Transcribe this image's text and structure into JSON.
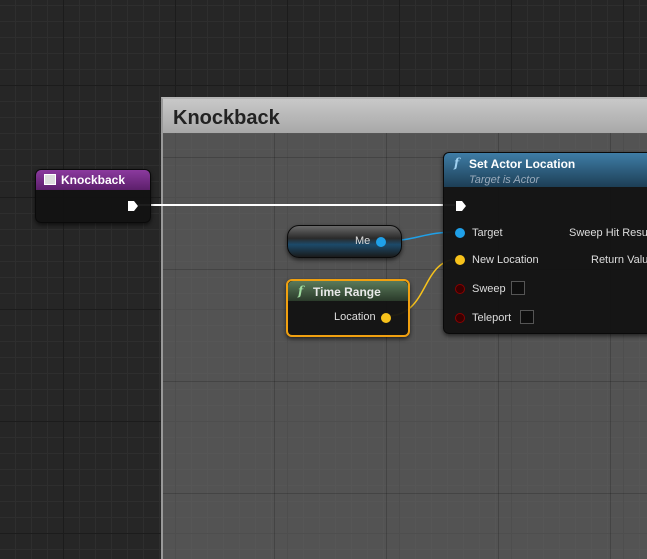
{
  "comment": {
    "title": "Knockback"
  },
  "event_node": {
    "title": "Knockback",
    "header_color": "#7a2c8c"
  },
  "me_node": {
    "label": "Me"
  },
  "time_range_node": {
    "title": "Time Range",
    "output_label": "Location",
    "header_color": "#3c5a3c"
  },
  "set_actor_node": {
    "title": "Set Actor Location",
    "subtitle": "Target is Actor",
    "header_color": "#2d5a78",
    "inputs": [
      {
        "label": "Target",
        "type": "object"
      },
      {
        "label": "New Location",
        "type": "vector"
      },
      {
        "label": "Sweep",
        "type": "bool"
      },
      {
        "label": "Teleport",
        "type": "bool"
      }
    ],
    "outputs": [
      {
        "label": "Sweep Hit Resu"
      },
      {
        "label": "Return Valu"
      }
    ]
  },
  "colors": {
    "object_pin": "#1fa0e8",
    "vector_pin": "#f7c21b",
    "bool_pin": "#8a0000",
    "exec_pin": "#ffffff"
  },
  "icons": {
    "function": "f",
    "event": "event-icon"
  }
}
